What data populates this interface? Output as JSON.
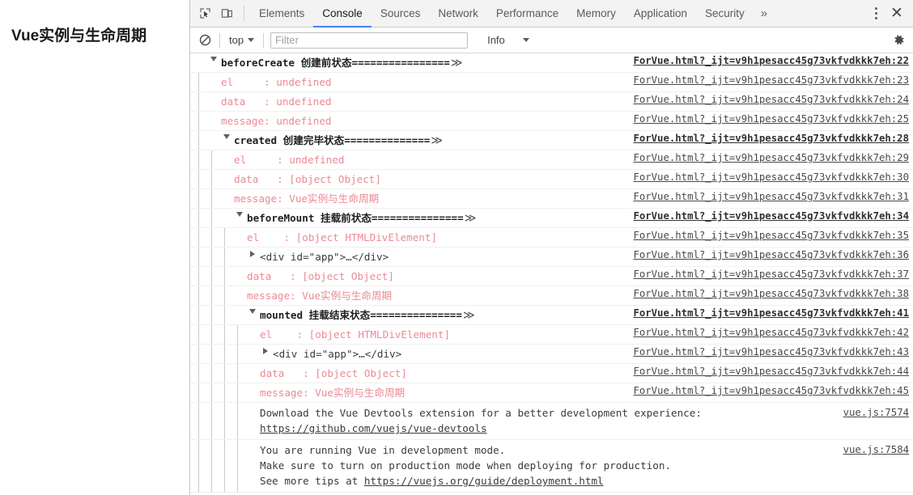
{
  "page": {
    "heading": "Vue实例与生命周期"
  },
  "devtools": {
    "icons": {
      "inspect": "inspect-element-icon",
      "device": "device-toolbar-icon",
      "clear": "clear-console-icon",
      "gear": "settings-gear-icon",
      "kebab": "more-options-icon",
      "close": "close-devtools-icon"
    },
    "tabs": [
      {
        "label": "Elements",
        "active": false
      },
      {
        "label": "Console",
        "active": true
      },
      {
        "label": "Sources",
        "active": false
      },
      {
        "label": "Network",
        "active": false
      },
      {
        "label": "Performance",
        "active": false
      },
      {
        "label": "Memory",
        "active": false
      },
      {
        "label": "Application",
        "active": false
      },
      {
        "label": "Security",
        "active": false
      }
    ],
    "more_tabs_label": "»",
    "close_label": "✕",
    "active_tab_accent": "#4285f4",
    "filterbar": {
      "context": "top",
      "filter_placeholder": "Filter",
      "filter_value": "",
      "level": "Info"
    }
  },
  "console": {
    "log_color": "#eb8a95",
    "rows": [
      {
        "name": "group-header-beforecreate",
        "indent": 0,
        "kind": "group",
        "disc": "down",
        "text": "beforeCreate 创建前状态================",
        "chev": "≫",
        "link": "ForVue.html?_ijt=v9h1pesacc45g73vkfvdkkk7eh:22",
        "bold_link": true
      },
      {
        "name": "log-row",
        "indent": 1,
        "kind": "log",
        "disc": "none",
        "text": "el     : undefined",
        "link": "ForVue.html?_ijt=v9h1pesacc45g73vkfvdkkk7eh:23",
        "bold_link": false
      },
      {
        "name": "log-row",
        "indent": 1,
        "kind": "log",
        "disc": "none",
        "text": "data   : undefined",
        "link": "ForVue.html?_ijt=v9h1pesacc45g73vkfvdkkk7eh:24",
        "bold_link": false
      },
      {
        "name": "log-row",
        "indent": 1,
        "kind": "log",
        "disc": "none",
        "text": "message: undefined",
        "link": "ForVue.html?_ijt=v9h1pesacc45g73vkfvdkkk7eh:25",
        "bold_link": false
      },
      {
        "name": "group-header-created",
        "indent": 1,
        "kind": "group",
        "disc": "down",
        "text": "created 创建完毕状态==============",
        "chev": "≫",
        "link": "ForVue.html?_ijt=v9h1pesacc45g73vkfvdkkk7eh:28",
        "bold_link": true
      },
      {
        "name": "log-row",
        "indent": 2,
        "kind": "log",
        "disc": "none",
        "text": "el     : undefined",
        "link": "ForVue.html?_ijt=v9h1pesacc45g73vkfvdkkk7eh:29",
        "bold_link": false
      },
      {
        "name": "log-row",
        "indent": 2,
        "kind": "log",
        "disc": "none",
        "text": "data   : [object Object]",
        "link": "ForVue.html?_ijt=v9h1pesacc45g73vkfvdkkk7eh:30",
        "bold_link": false
      },
      {
        "name": "log-row",
        "indent": 2,
        "kind": "log",
        "disc": "none",
        "text": "message: Vue实例与生命周期",
        "link": "ForVue.html?_ijt=v9h1pesacc45g73vkfvdkkk7eh:31",
        "bold_link": false
      },
      {
        "name": "group-header-beforemount",
        "indent": 2,
        "kind": "group",
        "disc": "down",
        "text": "beforeMount 挂载前状态===============",
        "chev": "≫",
        "link": "ForVue.html?_ijt=v9h1pesacc45g73vkfvdkkk7eh:34",
        "bold_link": true
      },
      {
        "name": "log-row",
        "indent": 3,
        "kind": "log",
        "disc": "none",
        "text": "el    : [object HTMLDivElement]",
        "link": "ForVue.html?_ijt=v9h1pesacc45g73vkfvdkkk7eh:35",
        "bold_link": false
      },
      {
        "name": "dom-node-row",
        "indent": 3,
        "kind": "dom",
        "disc": "right",
        "text": "<div id=\"app\">…</div>",
        "link": "ForVue.html?_ijt=v9h1pesacc45g73vkfvdkkk7eh:36",
        "bold_link": false
      },
      {
        "name": "log-row",
        "indent": 3,
        "kind": "log",
        "disc": "none",
        "text": "data   : [object Object]",
        "link": "ForVue.html?_ijt=v9h1pesacc45g73vkfvdkkk7eh:37",
        "bold_link": false
      },
      {
        "name": "log-row",
        "indent": 3,
        "kind": "log",
        "disc": "none",
        "text": "message: Vue实例与生命周期",
        "link": "ForVue.html?_ijt=v9h1pesacc45g73vkfvdkkk7eh:38",
        "bold_link": false
      },
      {
        "name": "group-header-mounted",
        "indent": 3,
        "kind": "group",
        "disc": "down",
        "text": "mounted 挂载结束状态===============",
        "chev": "≫",
        "link": "ForVue.html?_ijt=v9h1pesacc45g73vkfvdkkk7eh:41",
        "bold_link": true
      },
      {
        "name": "log-row",
        "indent": 4,
        "kind": "log",
        "disc": "none",
        "text": "el    : [object HTMLDivElement]",
        "link": "ForVue.html?_ijt=v9h1pesacc45g73vkfvdkkk7eh:42",
        "bold_link": false
      },
      {
        "name": "dom-node-row",
        "indent": 4,
        "kind": "dom",
        "disc": "right",
        "text": "<div id=\"app\">…</div>",
        "link": "ForVue.html?_ijt=v9h1pesacc45g73vkfvdkkk7eh:43",
        "bold_link": false
      },
      {
        "name": "log-row",
        "indent": 4,
        "kind": "log",
        "disc": "none",
        "text": "data   : [object Object]",
        "link": "ForVue.html?_ijt=v9h1pesacc45g73vkfvdkkk7eh:44",
        "bold_link": false
      },
      {
        "name": "log-row",
        "indent": 4,
        "kind": "log",
        "disc": "none",
        "text": "message: Vue实例与生命周期",
        "link": "ForVue.html?_ijt=v9h1pesacc45g73vkfvdkkk7eh:45",
        "bold_link": false
      },
      {
        "name": "vue-devtools-tip-row",
        "indent": 4,
        "kind": "multiline",
        "disc": "none",
        "bold_link": false,
        "link": "vue.js:7574",
        "lines": [
          {
            "text": "Download the Vue Devtools extension for a better development experience:",
            "link": false
          },
          {
            "text": "https://github.com/vuejs/vue-devtools",
            "link": true
          }
        ]
      },
      {
        "name": "vue-devmode-tip-row",
        "indent": 4,
        "kind": "multiline",
        "disc": "none",
        "bold_link": false,
        "link": "vue.js:7584",
        "lines": [
          {
            "text": "You are running Vue in development mode.",
            "link": false
          },
          {
            "text": "Make sure to turn on production mode when deploying for production.",
            "link": false
          },
          {
            "text": "See more tips at ",
            "link": false,
            "tail": "https://vuejs.org/guide/deployment.html"
          }
        ]
      }
    ]
  }
}
